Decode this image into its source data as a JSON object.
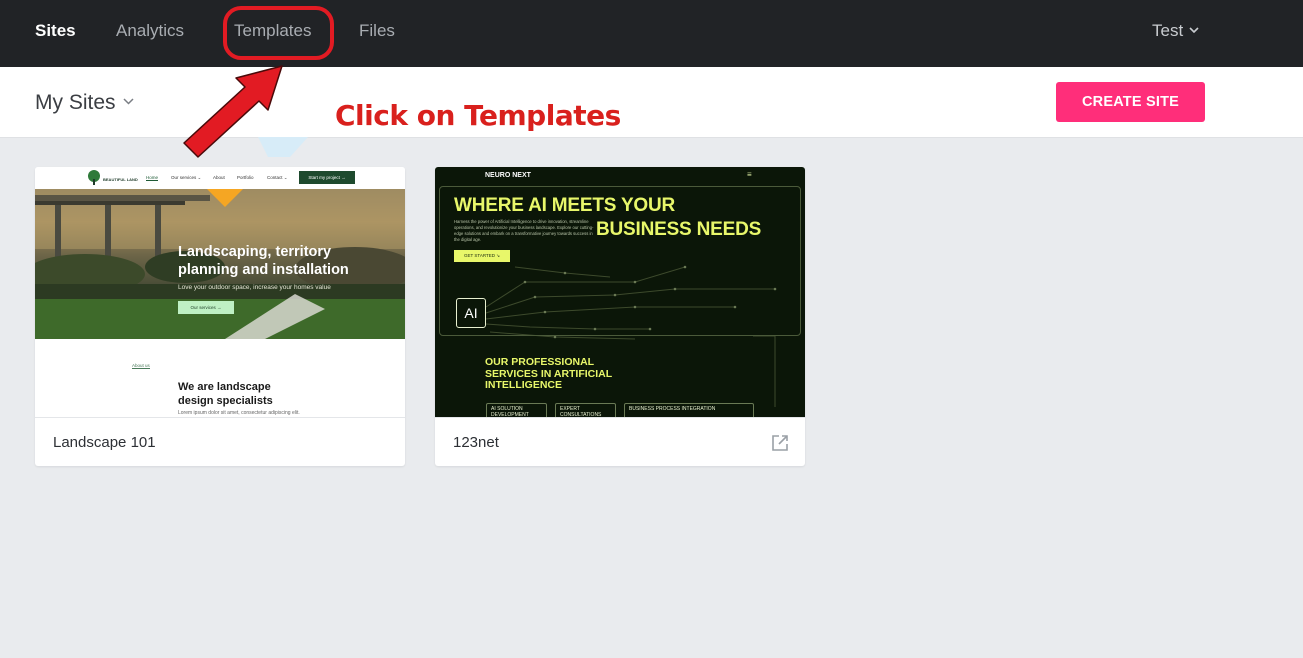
{
  "topnav": {
    "items": [
      {
        "label": "Sites",
        "active": true
      },
      {
        "label": "Analytics",
        "active": false
      },
      {
        "label": "Templates",
        "active": false
      },
      {
        "label": "Files",
        "active": false
      }
    ],
    "user": "Test"
  },
  "subheader": {
    "site_switcher": "My Sites",
    "create_button": "CREATE SITE"
  },
  "annotation": {
    "text": "Click on Templates",
    "color": "#d9201d"
  },
  "sites": [
    {
      "name": "Landscape 101",
      "preview": {
        "logo": "BEAUTIFUL LAND",
        "menu": [
          "Home",
          "Our services ⌄",
          "About",
          "Portfolio",
          "Contact ⌄"
        ],
        "cta": "Start my project →",
        "hero_title": "Landscaping, territory\nplanning and installation",
        "hero_subtitle": "Love your outdoor space, increase your homes value",
        "hero_button": "Our services →",
        "section_label": "About us",
        "section_title": "We are landscape\ndesign specialists",
        "section_text": "Lorem ipsum dolor sit amet, consectetur adipiscing elit."
      }
    },
    {
      "name": "123net",
      "has_external_link": true,
      "preview": {
        "logo": "NEURO NEXT",
        "menu_icon": "≡",
        "headline_1": "WHERE AI MEETS YOUR",
        "headline_2": "BUSINESS NEEDS",
        "intro": "Harness the power of Artificial Intelligence to drive innovation, streamline operations, and revolutionize your business landscape. Explore our cutting-edge solutions and embark on a transformative journey towards success in the digital age.",
        "button": "GET STARTED ↘",
        "chip": "AI",
        "services_title": "OUR PROFESSIONAL\nSERVICES IN ARTIFICIAL\nINTELLIGENCE",
        "services": [
          "AI SOLUTION\nDEVELOPMENT",
          "EXPERT\nCONSULTATIONS",
          "BUSINESS PROCESS INTEGRATION"
        ]
      }
    }
  ],
  "colors": {
    "nav_bg": "#212326",
    "accent": "#ff2e7a",
    "highlight": "#e21b23",
    "page_bg": "#e9ebee",
    "neuro_accent": "#e8f76a"
  }
}
